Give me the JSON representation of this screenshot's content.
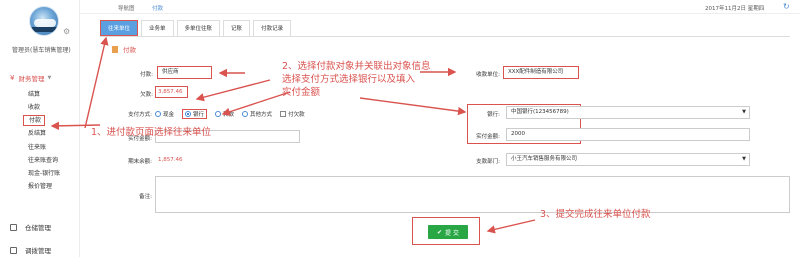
{
  "sidebar": {
    "user_name": "管理员(慧车销售管理)",
    "group_label": "财务管理",
    "items": [
      "结算",
      "收款",
      "付款",
      "反结算",
      "往来账",
      "往来账查询",
      "现金-银行账",
      "报价管理"
    ],
    "bottom_items": [
      "仓储管理",
      "调拨管理"
    ]
  },
  "topbar": {
    "crumbs": [
      "导航图",
      "付款"
    ],
    "datetime": "2017年11月2日  星期四"
  },
  "tabs": [
    "往来单位",
    "业务单",
    "多单位往账",
    "记账",
    "付款记录"
  ],
  "section_title": "付款",
  "form": {
    "payee_label": "付款:",
    "payee_value": "供应商",
    "debt_label": "欠款:",
    "debt_value": "3,857.46",
    "method_label": "支付方式:",
    "methods": [
      "现金",
      "银行",
      "转款",
      "其他方式"
    ],
    "checkbox_label": "付欠款",
    "paid_label": "实付金额:",
    "balance_label": "期末余额:",
    "balance_value": "1,857.46",
    "note_label": "备注:",
    "unit_label": "收款单位:",
    "unit_value": "XXX配件制造有限公司",
    "bank_label": "银行:",
    "bank_value": "中国银行(123456789)",
    "amount_label": "实付金额:",
    "amount_value": "2000",
    "dept_label": "支款部门:",
    "dept_value": "小王汽车销售服务有限公司",
    "submit_label": "提 交"
  },
  "annotations": {
    "step1": "1、进付款页面选择往来单位",
    "step2_line1": "2、选择付款对象并关联出对象信息",
    "step2_line2": "选择支付方式选择银行以及填入",
    "step2_line3": "实付金额",
    "step3": "3、提交完成往来单位付款"
  },
  "colors": {
    "accent_red": "#d9534f",
    "tab_blue": "#5aa0e0",
    "submit_green": "#29a745"
  }
}
